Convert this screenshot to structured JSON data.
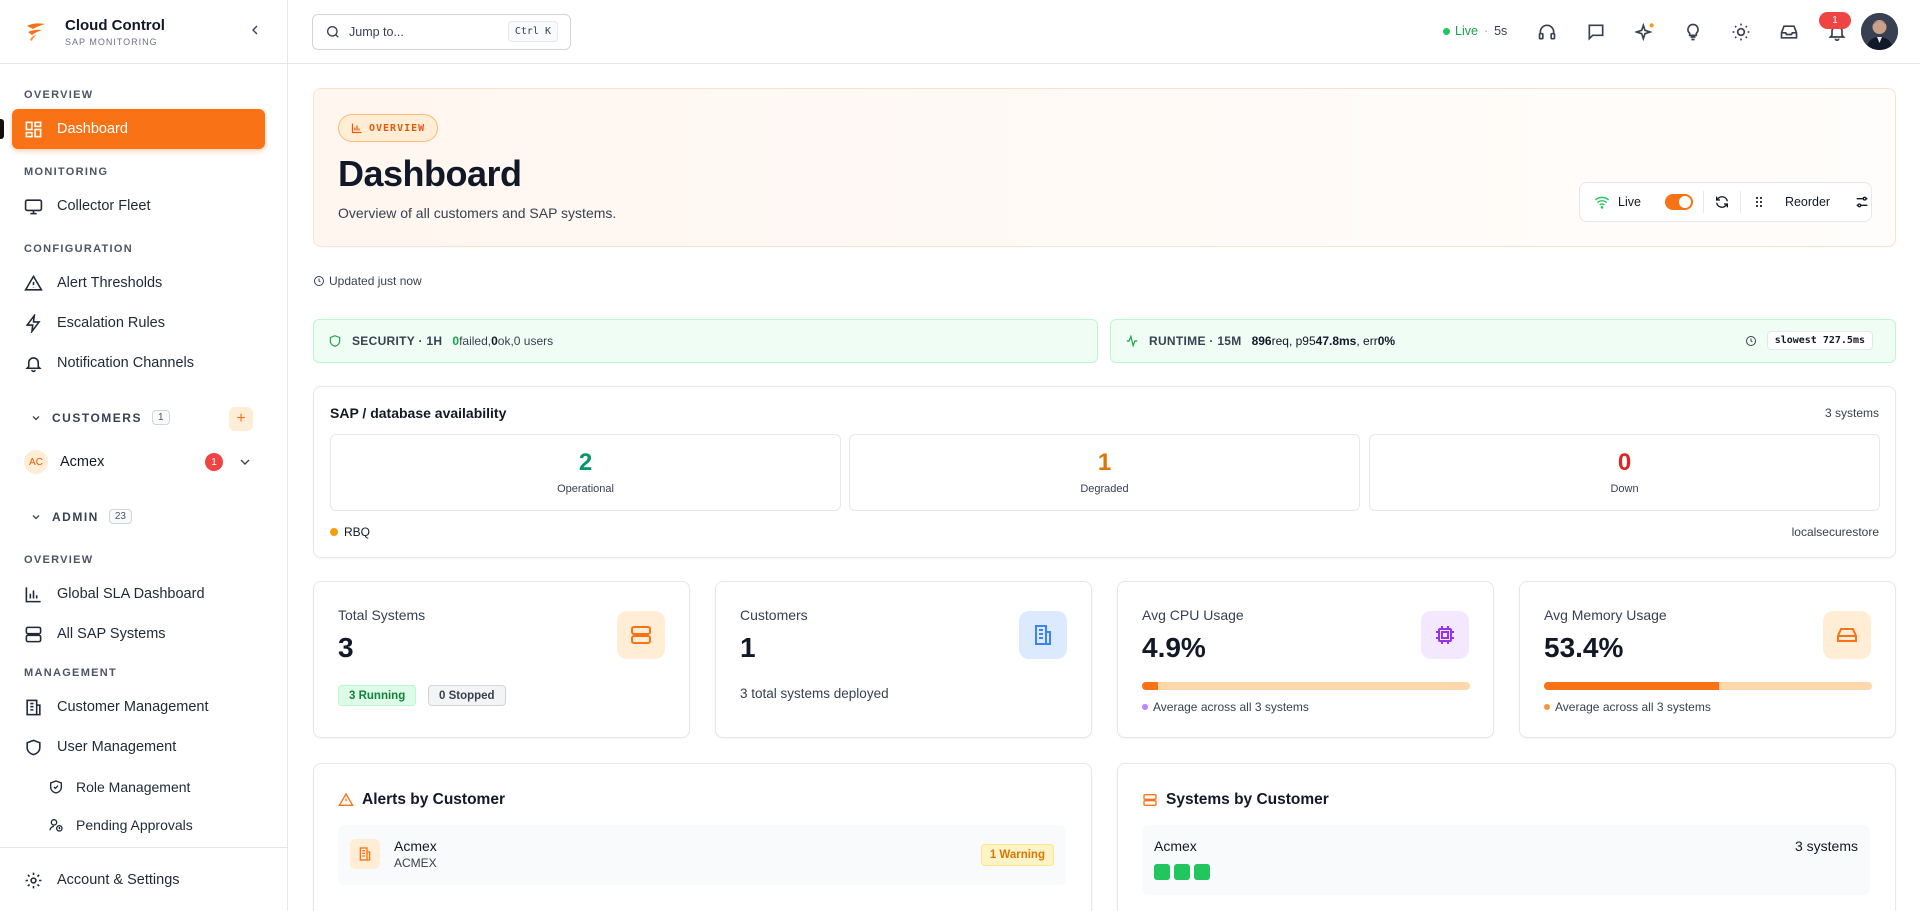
{
  "brand": {
    "title": "Cloud Control",
    "subtitle": "SAP MONITORING"
  },
  "sidebar": {
    "sections": {
      "overview": "OVERVIEW",
      "monitoring": "MONITORING",
      "configuration": "CONFIGURATION",
      "admin_overview": "OVERVIEW",
      "management": "MANAGEMENT"
    },
    "items": {
      "dashboard": "Dashboard",
      "collector_fleet": "Collector Fleet",
      "alert_thresholds": "Alert Thresholds",
      "escalation_rules": "Escalation Rules",
      "notification_channels": "Notification Channels",
      "global_sla": "Global SLA Dashboard",
      "all_sap_systems": "All SAP Systems",
      "customer_management": "Customer Management",
      "user_management": "User Management",
      "role_management": "Role Management",
      "pending_approvals": "Pending Approvals",
      "account_settings": "Account & Settings"
    },
    "customers": {
      "label": "CUSTOMERS",
      "count": "1",
      "add": "+",
      "list": [
        {
          "initials": "AC",
          "name": "Acmex",
          "badge": "1"
        }
      ]
    },
    "admin": {
      "label": "ADMIN",
      "count": "23"
    }
  },
  "topbar": {
    "search_placeholder": "Jump to...",
    "shortcut": "Ctrl K",
    "live_label": "Live",
    "live_sep": "·",
    "live_interval": "5s",
    "notification_count": "1",
    "icons": [
      "headset-icon",
      "chat-icon",
      "sparkles-icon",
      "lightbulb-icon",
      "sun-icon",
      "inbox-icon",
      "bell-icon"
    ]
  },
  "hero": {
    "pill": "OVERVIEW",
    "title": "Dashboard",
    "subtitle": "Overview of all customers and SAP systems.",
    "live_label": "Live",
    "live_on": true,
    "reorder_label": "Reorder"
  },
  "updated": "Updated just now",
  "security": {
    "tag": "SECURITY · 1H",
    "failed": "0",
    "failed_label": " failed, ",
    "ok": "0",
    "ok_label": " ok, ",
    "users": "0 users"
  },
  "runtime": {
    "tag": "RUNTIME · 15M",
    "req": "896",
    "req_label": " req, p95 ",
    "p95": "47.8ms",
    "err_label": ", err ",
    "err": "0%",
    "slowest": "slowest 727.5ms"
  },
  "availability": {
    "title": "SAP / database availability",
    "count": "3 systems",
    "tiles": [
      {
        "value": "2",
        "label": "Operational",
        "color": "#059669"
      },
      {
        "value": "1",
        "label": "Degraded",
        "color": "#d97706"
      },
      {
        "value": "0",
        "label": "Down",
        "color": "#dc2626"
      }
    ],
    "system": "RBQ",
    "store": "localsecurestore"
  },
  "stats": {
    "total_systems": {
      "label": "Total Systems",
      "value": "3",
      "running": "3 Running",
      "stopped": "0 Stopped"
    },
    "customers": {
      "label": "Customers",
      "value": "1",
      "note": "3 total systems deployed"
    },
    "cpu": {
      "label": "Avg CPU Usage",
      "value": "4.9%",
      "fill": 4.9,
      "note": "Average across all 3 systems"
    },
    "memory": {
      "label": "Avg Memory Usage",
      "value": "53.4%",
      "fill": 53.4,
      "note": "Average across all 3 systems"
    }
  },
  "alerts_by_customer": {
    "title": "Alerts by Customer",
    "rows": [
      {
        "name": "Acmex",
        "code": "ACMEX",
        "badge": "1 Warning"
      }
    ]
  },
  "systems_by_customer": {
    "title": "Systems by Customer",
    "rows": [
      {
        "name": "Acmex",
        "count": "3 systems",
        "systems": [
          "running",
          "running",
          "running"
        ]
      }
    ]
  },
  "colors": {
    "accent": "#f97316",
    "success": "#22c55e",
    "warning": "#d97706",
    "danger": "#ef4444"
  }
}
